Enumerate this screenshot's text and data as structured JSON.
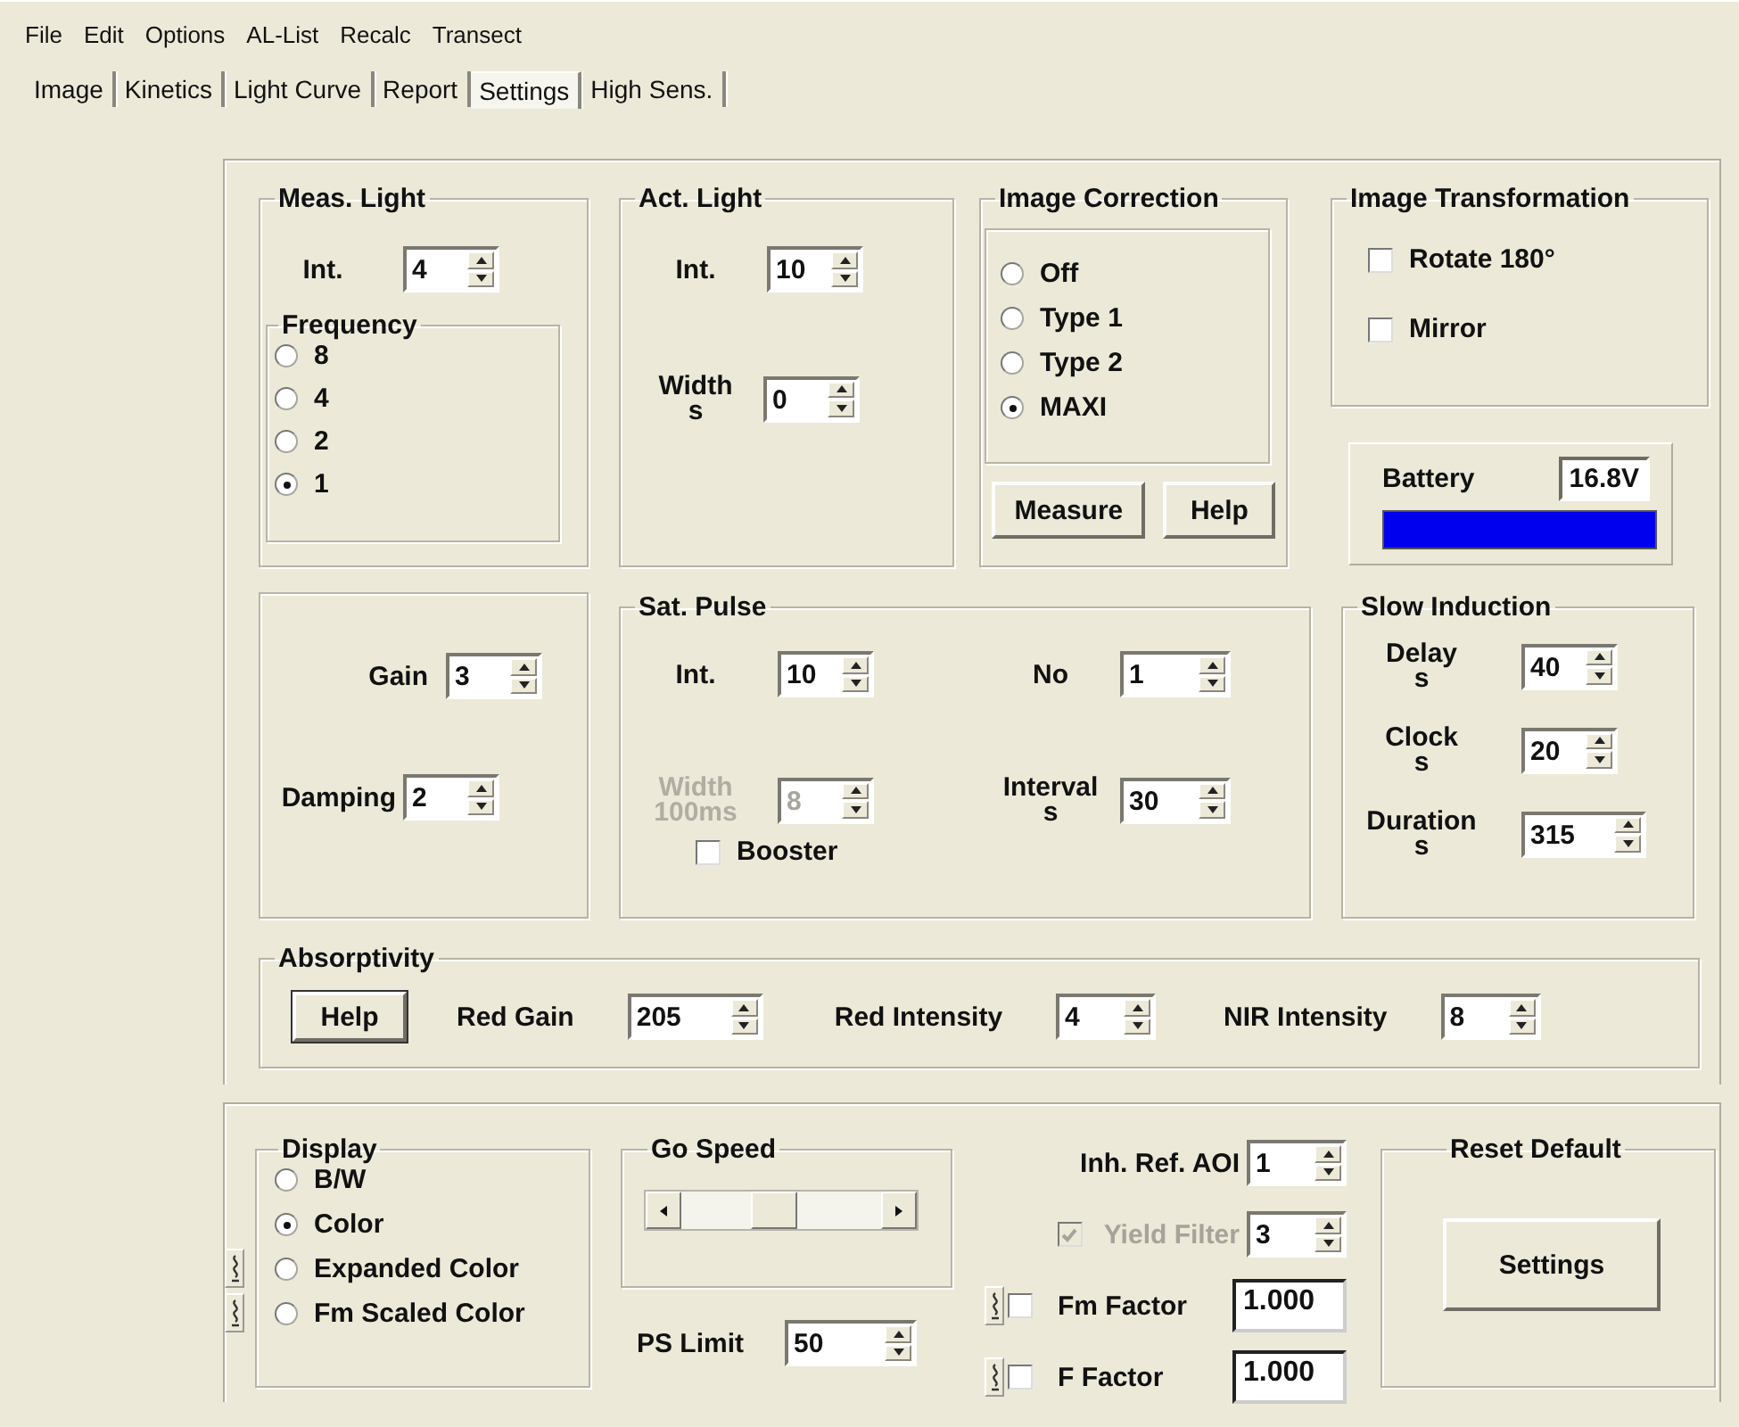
{
  "menu": [
    {
      "label": "File"
    },
    {
      "label": "Edit"
    },
    {
      "label": "Options"
    },
    {
      "label": "AL-List"
    },
    {
      "label": "Recalc"
    },
    {
      "label": "Transect"
    }
  ],
  "tabs": [
    {
      "label": "Image",
      "selected": false
    },
    {
      "label": "Kinetics",
      "selected": false
    },
    {
      "label": "Light Curve",
      "selected": false
    },
    {
      "label": "Report",
      "selected": false
    },
    {
      "label": "Settings",
      "selected": true
    },
    {
      "label": "High Sens.",
      "selected": false
    }
  ],
  "meas_light": {
    "title": "Meas. Light",
    "int": {
      "label": "Int.",
      "value": "4",
      "disabled": false
    },
    "frequency": {
      "title": "Frequency",
      "options": [
        {
          "label": "8",
          "selected": false
        },
        {
          "label": "4",
          "selected": false
        },
        {
          "label": "2",
          "selected": false
        },
        {
          "label": "1",
          "selected": true
        }
      ]
    }
  },
  "act_light": {
    "title": "Act. Light",
    "int": {
      "label": "Int.",
      "value": "10",
      "disabled": false
    },
    "width": {
      "label": "Width",
      "unit": "s",
      "value": "0",
      "disabled": false
    }
  },
  "image_correction": {
    "title": "Image Correction",
    "options": [
      {
        "label": "Off",
        "selected": false
      },
      {
        "label": "Type 1",
        "selected": false
      },
      {
        "label": "Type 2",
        "selected": false
      },
      {
        "label": "MAXI",
        "selected": true
      }
    ],
    "buttons": [
      "Measure",
      "Help"
    ]
  },
  "image_transformation": {
    "title": "Image Transformation",
    "options": [
      {
        "label": "Rotate 180°",
        "checked": false
      },
      {
        "label": "Mirror",
        "checked": false
      }
    ]
  },
  "battery": {
    "label": "Battery",
    "value": "16.8V",
    "level": 1
  },
  "gain_panel": {
    "gain": {
      "label": "Gain",
      "value": "3",
      "disabled": false
    },
    "damping": {
      "label": "Damping",
      "value": "2",
      "disabled": false
    }
  },
  "sat_pulse": {
    "title": "Sat. Pulse",
    "int": {
      "label": "Int.",
      "value": "10",
      "disabled": false
    },
    "no": {
      "label": "No",
      "value": "1",
      "disabled": false
    },
    "width": {
      "label": "Width",
      "unit": "100ms",
      "value": "8",
      "disabled": true
    },
    "interval": {
      "label": "Interval",
      "unit": "s",
      "value": "30",
      "disabled": false
    },
    "booster": {
      "label": "Booster",
      "checked": false
    }
  },
  "slow_induction": {
    "title": "Slow Induction",
    "fields": [
      {
        "label": "Delay",
        "unit": "s",
        "value": "40",
        "disabled": false
      },
      {
        "label": "Clock",
        "unit": "s",
        "value": "20",
        "disabled": false
      },
      {
        "label": "Duration",
        "unit": "s",
        "value": "315",
        "disabled": false
      }
    ]
  },
  "absorptivity": {
    "title": "Absorptivity",
    "help": "Help",
    "fields": [
      {
        "label": "Red Gain",
        "value": "205",
        "disabled": false
      },
      {
        "label": "Red Intensity",
        "value": "4",
        "disabled": false
      },
      {
        "label": "NIR Intensity",
        "value": "8",
        "disabled": false
      }
    ]
  },
  "display": {
    "title": "Display",
    "options": [
      {
        "label": "B/W",
        "selected": false,
        "pinned": false
      },
      {
        "label": "Color",
        "selected": true,
        "pinned": false
      },
      {
        "label": "Expanded Color",
        "selected": false,
        "pinned": true
      },
      {
        "label": "Fm Scaled Color",
        "selected": false,
        "pinned": true
      }
    ]
  },
  "go_speed": {
    "title": "Go Speed",
    "level": 0.45
  },
  "ps_limit": {
    "label": "PS Limit",
    "value": "50",
    "disabled": false
  },
  "inh_ref_aoi": {
    "label": "Inh. Ref. AOI",
    "value": "1",
    "disabled": false
  },
  "yield_filter": {
    "label": "Yield Filter",
    "checked": true,
    "disabled": true,
    "value": "3"
  },
  "factors": [
    {
      "label": "Fm Factor",
      "checked": false,
      "value": "1.000",
      "pinned": true
    },
    {
      "label": "F Factor",
      "checked": false,
      "value": "1.000",
      "pinned": true
    }
  ],
  "reset_default": {
    "title": "Reset Default",
    "button": "Settings"
  }
}
